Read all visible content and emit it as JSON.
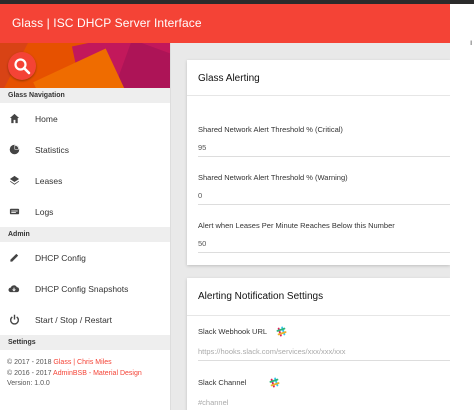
{
  "app": {
    "title": "Glass | ISC DHCP Server Interface"
  },
  "sidebar": {
    "nav_header": "Glass Navigation",
    "nav_items": [
      {
        "label": "Home",
        "icon": "home-icon"
      },
      {
        "label": "Statistics",
        "icon": "pie-chart-icon"
      },
      {
        "label": "Leases",
        "icon": "layers-icon"
      },
      {
        "label": "Logs",
        "icon": "logs-icon"
      }
    ],
    "admin_header": "Admin",
    "admin_items": [
      {
        "label": "DHCP Config",
        "icon": "pencil-icon"
      },
      {
        "label": "DHCP Config Snapshots",
        "icon": "cloud-icon"
      },
      {
        "label": "Start / Stop / Restart",
        "icon": "power-icon"
      }
    ],
    "settings_header": "Settings",
    "footer": {
      "line1_prefix": "© 2017 - 2018 ",
      "line1_link": "Glass | Chris Miles",
      "line2_prefix": "© 2016 - 2017 ",
      "line2_link": "AdminBSB - Material Design",
      "version_label": "Version:",
      "version": "1.0.0"
    }
  },
  "alerting": {
    "title": "Glass Alerting",
    "fields": [
      {
        "label": "Shared Network Alert Threshold % (Critical)",
        "value": "95"
      },
      {
        "label": "Shared Network Alert Threshold % (Warning)",
        "value": "0"
      },
      {
        "label": "Alert when Leases Per Minute Reaches Below this Number",
        "value": "50"
      }
    ]
  },
  "notifications": {
    "title": "Alerting Notification Settings",
    "fields": [
      {
        "label": "Slack Webhook URL",
        "placeholder": "https://hooks.slack.com/services/xxx/xxx/xxx",
        "icon": "slack-icon"
      },
      {
        "label": "Slack Channel",
        "placeholder": "#channel",
        "icon": "slack-icon"
      }
    ]
  },
  "colors": {
    "accent": "#f44336",
    "sidebar_header_bg": "#eeeeee",
    "page_bg": "#e9e9e9"
  }
}
